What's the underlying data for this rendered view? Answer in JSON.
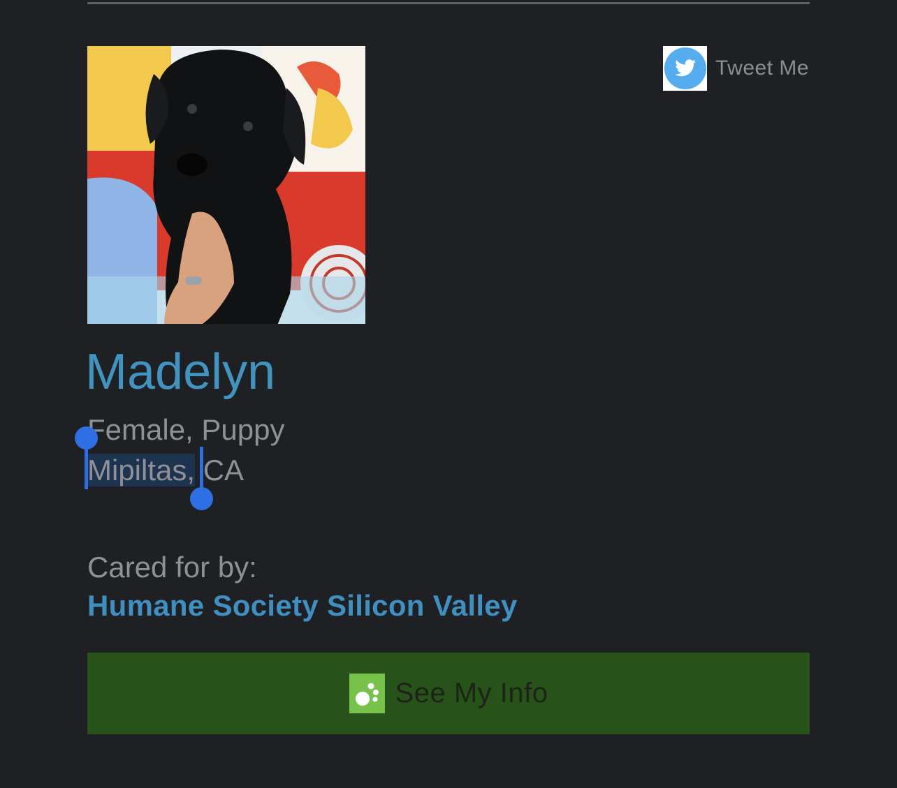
{
  "social": {
    "tweet_label": "Tweet Me"
  },
  "pet": {
    "name": "Madelyn",
    "description": "Female, Puppy",
    "location_selected": "Mipiltas,",
    "location_rest": " CA"
  },
  "shelter": {
    "cared_for_label": "Cared for by:",
    "name": "Humane Society Silicon Valley"
  },
  "actions": {
    "see_info_label": "See My Info"
  },
  "colors": {
    "background": "#1f2024",
    "link_blue": "#4193c0",
    "button_green": "#27531a",
    "selection_handle": "#2f6fe6"
  }
}
